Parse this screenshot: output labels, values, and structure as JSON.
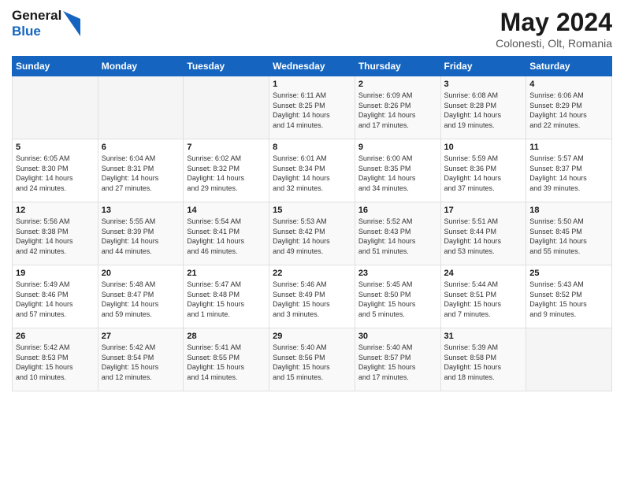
{
  "header": {
    "logo_line1": "General",
    "logo_line2": "Blue",
    "main_title": "May 2024",
    "subtitle": "Colonesti, Olt, Romania"
  },
  "days_of_week": [
    "Sunday",
    "Monday",
    "Tuesday",
    "Wednesday",
    "Thursday",
    "Friday",
    "Saturday"
  ],
  "weeks": [
    [
      {
        "day": "",
        "info": ""
      },
      {
        "day": "",
        "info": ""
      },
      {
        "day": "",
        "info": ""
      },
      {
        "day": "1",
        "info": "Sunrise: 6:11 AM\nSunset: 8:25 PM\nDaylight: 14 hours\nand 14 minutes."
      },
      {
        "day": "2",
        "info": "Sunrise: 6:09 AM\nSunset: 8:26 PM\nDaylight: 14 hours\nand 17 minutes."
      },
      {
        "day": "3",
        "info": "Sunrise: 6:08 AM\nSunset: 8:28 PM\nDaylight: 14 hours\nand 19 minutes."
      },
      {
        "day": "4",
        "info": "Sunrise: 6:06 AM\nSunset: 8:29 PM\nDaylight: 14 hours\nand 22 minutes."
      }
    ],
    [
      {
        "day": "5",
        "info": "Sunrise: 6:05 AM\nSunset: 8:30 PM\nDaylight: 14 hours\nand 24 minutes."
      },
      {
        "day": "6",
        "info": "Sunrise: 6:04 AM\nSunset: 8:31 PM\nDaylight: 14 hours\nand 27 minutes."
      },
      {
        "day": "7",
        "info": "Sunrise: 6:02 AM\nSunset: 8:32 PM\nDaylight: 14 hours\nand 29 minutes."
      },
      {
        "day": "8",
        "info": "Sunrise: 6:01 AM\nSunset: 8:34 PM\nDaylight: 14 hours\nand 32 minutes."
      },
      {
        "day": "9",
        "info": "Sunrise: 6:00 AM\nSunset: 8:35 PM\nDaylight: 14 hours\nand 34 minutes."
      },
      {
        "day": "10",
        "info": "Sunrise: 5:59 AM\nSunset: 8:36 PM\nDaylight: 14 hours\nand 37 minutes."
      },
      {
        "day": "11",
        "info": "Sunrise: 5:57 AM\nSunset: 8:37 PM\nDaylight: 14 hours\nand 39 minutes."
      }
    ],
    [
      {
        "day": "12",
        "info": "Sunrise: 5:56 AM\nSunset: 8:38 PM\nDaylight: 14 hours\nand 42 minutes."
      },
      {
        "day": "13",
        "info": "Sunrise: 5:55 AM\nSunset: 8:39 PM\nDaylight: 14 hours\nand 44 minutes."
      },
      {
        "day": "14",
        "info": "Sunrise: 5:54 AM\nSunset: 8:41 PM\nDaylight: 14 hours\nand 46 minutes."
      },
      {
        "day": "15",
        "info": "Sunrise: 5:53 AM\nSunset: 8:42 PM\nDaylight: 14 hours\nand 49 minutes."
      },
      {
        "day": "16",
        "info": "Sunrise: 5:52 AM\nSunset: 8:43 PM\nDaylight: 14 hours\nand 51 minutes."
      },
      {
        "day": "17",
        "info": "Sunrise: 5:51 AM\nSunset: 8:44 PM\nDaylight: 14 hours\nand 53 minutes."
      },
      {
        "day": "18",
        "info": "Sunrise: 5:50 AM\nSunset: 8:45 PM\nDaylight: 14 hours\nand 55 minutes."
      }
    ],
    [
      {
        "day": "19",
        "info": "Sunrise: 5:49 AM\nSunset: 8:46 PM\nDaylight: 14 hours\nand 57 minutes."
      },
      {
        "day": "20",
        "info": "Sunrise: 5:48 AM\nSunset: 8:47 PM\nDaylight: 14 hours\nand 59 minutes."
      },
      {
        "day": "21",
        "info": "Sunrise: 5:47 AM\nSunset: 8:48 PM\nDaylight: 15 hours\nand 1 minute."
      },
      {
        "day": "22",
        "info": "Sunrise: 5:46 AM\nSunset: 8:49 PM\nDaylight: 15 hours\nand 3 minutes."
      },
      {
        "day": "23",
        "info": "Sunrise: 5:45 AM\nSunset: 8:50 PM\nDaylight: 15 hours\nand 5 minutes."
      },
      {
        "day": "24",
        "info": "Sunrise: 5:44 AM\nSunset: 8:51 PM\nDaylight: 15 hours\nand 7 minutes."
      },
      {
        "day": "25",
        "info": "Sunrise: 5:43 AM\nSunset: 8:52 PM\nDaylight: 15 hours\nand 9 minutes."
      }
    ],
    [
      {
        "day": "26",
        "info": "Sunrise: 5:42 AM\nSunset: 8:53 PM\nDaylight: 15 hours\nand 10 minutes."
      },
      {
        "day": "27",
        "info": "Sunrise: 5:42 AM\nSunset: 8:54 PM\nDaylight: 15 hours\nand 12 minutes."
      },
      {
        "day": "28",
        "info": "Sunrise: 5:41 AM\nSunset: 8:55 PM\nDaylight: 15 hours\nand 14 minutes."
      },
      {
        "day": "29",
        "info": "Sunrise: 5:40 AM\nSunset: 8:56 PM\nDaylight: 15 hours\nand 15 minutes."
      },
      {
        "day": "30",
        "info": "Sunrise: 5:40 AM\nSunset: 8:57 PM\nDaylight: 15 hours\nand 17 minutes."
      },
      {
        "day": "31",
        "info": "Sunrise: 5:39 AM\nSunset: 8:58 PM\nDaylight: 15 hours\nand 18 minutes."
      },
      {
        "day": "",
        "info": ""
      }
    ]
  ]
}
